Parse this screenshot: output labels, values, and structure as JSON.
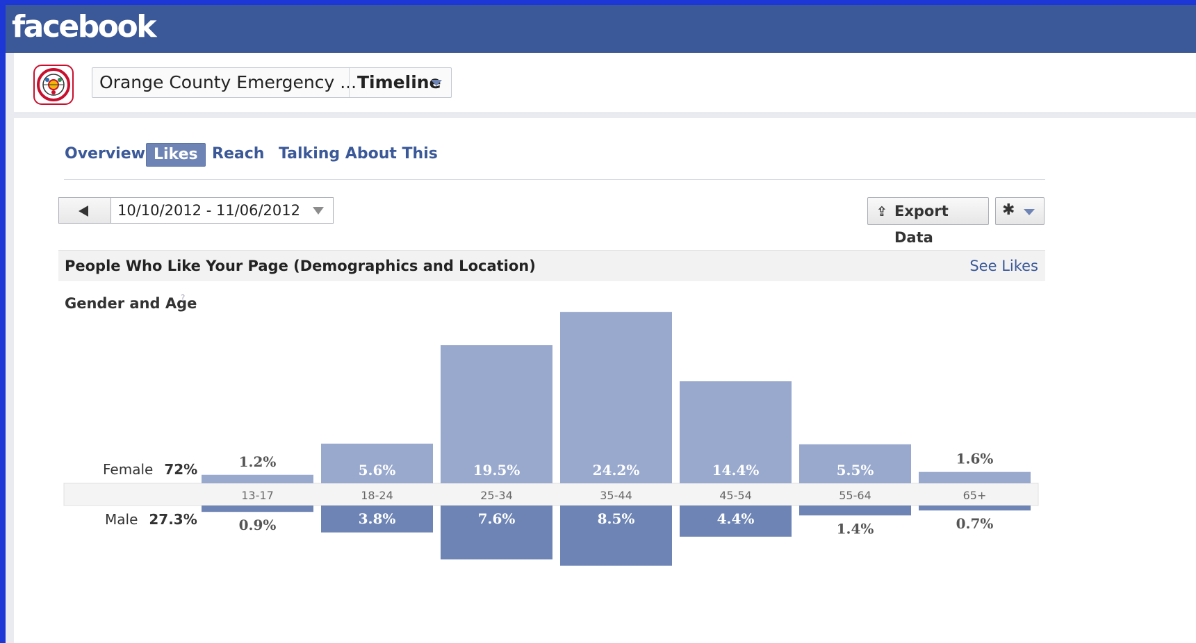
{
  "app": {
    "logo_text": "facebook"
  },
  "page": {
    "name": "Orange County Emergency ...",
    "view": "Timeline"
  },
  "tabs": [
    {
      "label": "Overview",
      "active": false
    },
    {
      "label": "Likes",
      "active": true
    },
    {
      "label": "Reach",
      "active": false
    },
    {
      "label": "Talking About This",
      "active": false
    }
  ],
  "date_range": {
    "value": "10/10/2012 - 11/06/2012"
  },
  "toolbar": {
    "export_label": "Export Data",
    "export_icon": "upload-icon",
    "settings_icon": "gear-icon"
  },
  "section": {
    "title": "People Who Like Your Page (Demographics and Location)",
    "link": "See Likes"
  },
  "chart_title": "Gender and Age",
  "colors": {
    "fb_blue": "#3b5998",
    "female_bar": "#98a9cd",
    "male_bar": "#6d84b4",
    "background": "#1d36d6"
  },
  "chart_data": {
    "type": "bar",
    "title": "Gender and Age",
    "categories": [
      "13-17",
      "18-24",
      "25-34",
      "35-44",
      "45-54",
      "55-64",
      "65+"
    ],
    "series": [
      {
        "name": "Female",
        "total": "72%",
        "values": [
          1.2,
          5.6,
          19.5,
          24.2,
          14.4,
          5.5,
          1.6
        ],
        "labels": [
          "1.2%",
          "5.6%",
          "19.5%",
          "24.2%",
          "14.4%",
          "5.5%",
          "1.6%"
        ]
      },
      {
        "name": "Male",
        "total": "27.3%",
        "values": [
          0.9,
          3.8,
          7.6,
          8.5,
          4.4,
          1.4,
          0.7
        ],
        "labels": [
          "0.9%",
          "3.8%",
          "7.6%",
          "8.5%",
          "4.4%",
          "1.4%",
          "0.7%"
        ]
      }
    ]
  }
}
